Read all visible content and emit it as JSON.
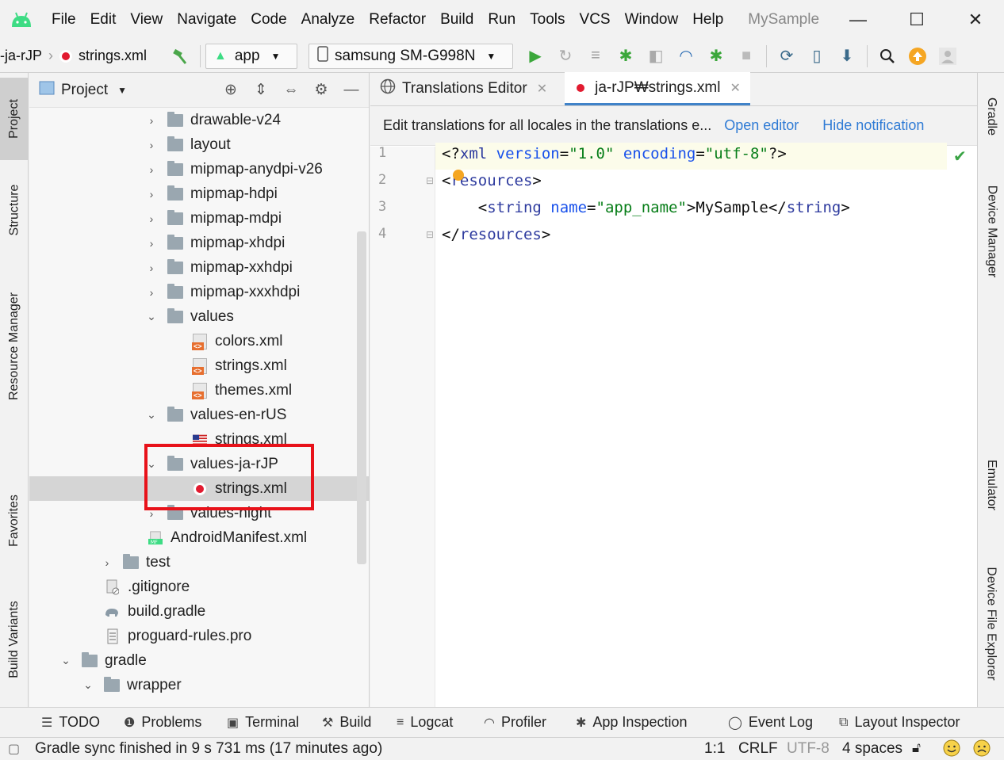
{
  "menubar": {
    "items": [
      "File",
      "Edit",
      "View",
      "Navigate",
      "Code",
      "Analyze",
      "Refactor",
      "Build",
      "Run",
      "Tools",
      "VCS",
      "Window",
      "Help"
    ],
    "project_title": "MySample",
    "minimize": "—",
    "maximize": "☐",
    "close": "✕"
  },
  "toolbar": {
    "breadcrumb_folder": "-ja-rJP",
    "breadcrumb_file": "strings.xml",
    "run_config": "app",
    "device": "samsung SM-G998N"
  },
  "left_stripe": {
    "project": "Project",
    "structure": "Structure",
    "resource_manager": "Resource Manager",
    "favorites": "Favorites",
    "build_variants": "Build Variants"
  },
  "right_stripe": {
    "gradle": "Gradle",
    "device_manager": "Device Manager",
    "emulator": "Emulator",
    "device_file_explorer": "Device File Explorer"
  },
  "project_panel": {
    "title": "Project",
    "tree": [
      {
        "label": "drawable-v24",
        "kind": "folder",
        "expanded": false
      },
      {
        "label": "layout",
        "kind": "folder",
        "expanded": false
      },
      {
        "label": "mipmap-anydpi-v26",
        "kind": "folder",
        "expanded": false
      },
      {
        "label": "mipmap-hdpi",
        "kind": "folder",
        "expanded": false
      },
      {
        "label": "mipmap-mdpi",
        "kind": "folder",
        "expanded": false
      },
      {
        "label": "mipmap-xhdpi",
        "kind": "folder",
        "expanded": false
      },
      {
        "label": "mipmap-xxhdpi",
        "kind": "folder",
        "expanded": false
      },
      {
        "label": "mipmap-xxxhdpi",
        "kind": "folder",
        "expanded": false
      },
      {
        "label": "values",
        "kind": "folder",
        "expanded": true
      },
      {
        "label": "colors.xml",
        "kind": "xml"
      },
      {
        "label": "strings.xml",
        "kind": "xml"
      },
      {
        "label": "themes.xml",
        "kind": "xml"
      },
      {
        "label": "values-en-rUS",
        "kind": "folder",
        "expanded": true
      },
      {
        "label": "strings.xml",
        "kind": "us-flag"
      },
      {
        "label": "values-ja-rJP",
        "kind": "folder",
        "expanded": true
      },
      {
        "label": "strings.xml",
        "kind": "jp-flag",
        "selected": true
      },
      {
        "label": "values-night",
        "kind": "folder",
        "expanded": false
      },
      {
        "label": "AndroidManifest.xml",
        "kind": "manifest"
      },
      {
        "label": "test",
        "kind": "folder",
        "expanded": false
      },
      {
        "label": ".gitignore",
        "kind": "file"
      },
      {
        "label": "build.gradle",
        "kind": "gradle"
      },
      {
        "label": "proguard-rules.pro",
        "kind": "file"
      },
      {
        "label": "gradle",
        "kind": "folder",
        "expanded": true
      },
      {
        "label": "wrapper",
        "kind": "folder",
        "expanded": true
      }
    ]
  },
  "editor": {
    "tabs": [
      {
        "label": "Translations Editor",
        "active": false
      },
      {
        "label": "ja-rJP₩strings.xml",
        "active": true
      }
    ],
    "notification": {
      "text": "Edit translations for all locales in the translations e...",
      "open_link": "Open editor",
      "hide_link": "Hide notification"
    },
    "line_numbers": [
      "1",
      "2",
      "3",
      "4"
    ],
    "code": {
      "l1_a": "<?",
      "l1_b": "xml ",
      "l1_c": "version",
      "l1_d": "=",
      "l1_e": "\"1.0\"",
      "l1_f": " encoding",
      "l1_g": "=",
      "l1_h": "\"utf-8\"",
      "l1_i": "?>",
      "l2_a": "<",
      "l2_b": "resources",
      "l2_c": ">",
      "l3_a": "    <",
      "l3_b": "string ",
      "l3_c": "name",
      "l3_d": "=",
      "l3_e": "\"app_name\"",
      "l3_f": ">MySample</",
      "l3_g": "string",
      "l3_h": ">",
      "l4_a": "</",
      "l4_b": "resources",
      "l4_c": ">"
    }
  },
  "bottom_tools": [
    "TODO",
    "Problems",
    "Terminal",
    "Build",
    "Logcat",
    "Profiler",
    "App Inspection",
    "Event Log",
    "Layout Inspector"
  ],
  "status": {
    "message": "Gradle sync finished in 9 s 731 ms (17 minutes ago)",
    "position": "1:1",
    "line_sep": "CRLF",
    "encoding": "UTF-8",
    "indent": "4 spaces"
  }
}
